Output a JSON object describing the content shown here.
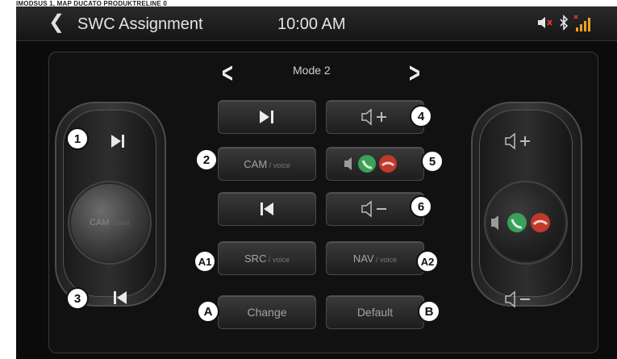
{
  "doc_header": "IMODSUS 1, MAP DUCATO PRODUKTRELINE 0",
  "statusbar": {
    "title": "SWC Assignment",
    "time": "10:00 AM"
  },
  "mode": {
    "label": "Mode 2"
  },
  "buttons": {
    "cam_voice_left": {
      "main": "CAM",
      "sub": " / voice"
    },
    "src_voice": {
      "main": "SRC",
      "sub": " / voice"
    },
    "nav_voice": {
      "main": "NAV",
      "sub": " / voice"
    },
    "change": "Change",
    "default": "Default"
  },
  "knob_left": {
    "main": "CAM",
    "sub": " / voice"
  },
  "callouts": {
    "c1": "1",
    "c2": "2",
    "c3": "3",
    "c4": "4",
    "c5": "5",
    "c6": "6",
    "a1": "A1",
    "a2": "A2",
    "a": "A",
    "b": "B"
  },
  "colors": {
    "screen_bg": "#0b0b0b",
    "accept": "#3aa05a",
    "reject": "#c0392b",
    "mute_x": "#e0352b"
  },
  "icons": [
    "chevron-left-icon",
    "mute-speaker-icon",
    "bluetooth-icon",
    "signal-icon",
    "next-track-icon",
    "previous-track-icon",
    "volume-up-icon",
    "volume-down-icon",
    "call-accept-icon",
    "call-reject-icon"
  ]
}
